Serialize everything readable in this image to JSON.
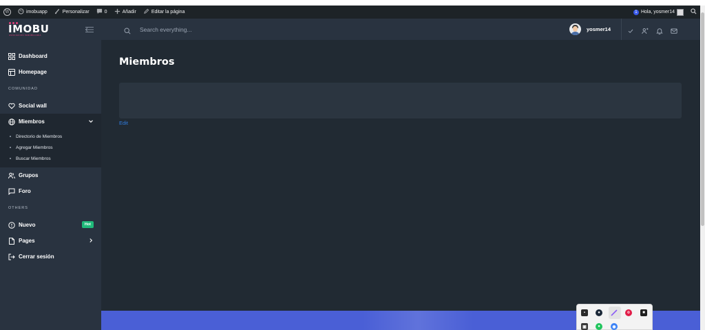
{
  "admin_bar": {
    "site_name": "imobuapp",
    "customize": "Personalizar",
    "comments_count": "0",
    "add_new": "Añadir",
    "edit_page": "Editar la página",
    "notif_count": "1",
    "greeting": "Hola, yosmer14"
  },
  "sidebar": {
    "logo_text": "IMOBU",
    "logo_sub": "ASOCIACION INMOBILIARIA",
    "items_top": [
      {
        "label": "Dashboard",
        "icon": "grid-icon"
      },
      {
        "label": "Homepage",
        "icon": "layout-icon"
      }
    ],
    "section_comunidad": "COMUNIDAD",
    "social_wall": "Social wall",
    "miembros": "Miembros",
    "sub_items": [
      "Directorio de Miembros",
      "Agregar Miembros",
      "Buscar Miembros"
    ],
    "grupos": "Grupos",
    "foro": "Foro",
    "section_others": "OTHERS",
    "nuevo": "Nuevo",
    "nuevo_badge": "Hot",
    "pages": "Pages",
    "logout": "Cerrar sesión"
  },
  "topbar": {
    "search_placeholder": "Search everything...",
    "username": "yosmer14"
  },
  "main": {
    "title": "Miembros",
    "edit_link": "Edit"
  },
  "colors": {
    "sidebar_bg": "#293340",
    "main_bg": "#212a33",
    "accent_green": "#1fba7a",
    "footer_blue": "#4a5fd6",
    "link_blue": "#2f7de1"
  }
}
